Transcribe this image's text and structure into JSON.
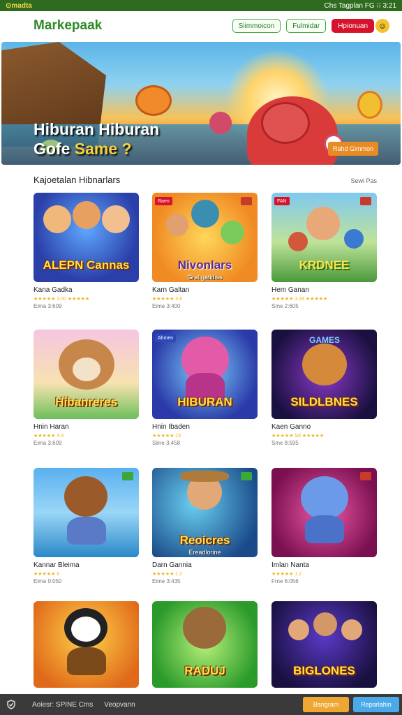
{
  "statusbar": {
    "left": "⊙madta",
    "right": "Chs Tagplan  FG  ⁝⁝ 3:21"
  },
  "topbar": {
    "title": "Markepaak",
    "btn1": "Siimmoicon",
    "btn2": "Fulmidar",
    "btn3": "Hpionuan",
    "smiley": "☺"
  },
  "hero": {
    "line1": "Hiburan Hiburan",
    "line2a": "Gofe ",
    "line2b": "Same ?",
    "cta": "Rahd Gimmon"
  },
  "section": {
    "heading": "Kajoetalan Hibnarlars",
    "link": "Sewi Pas"
  },
  "cards": [
    {
      "title": "ALEPN Cannas",
      "sub": "",
      "name": "Kana Gadka",
      "rating": "★★★★★ 3.00 ★★★★★",
      "meta": "Eima 3:609",
      "tag": ""
    },
    {
      "title": "Nivonlars",
      "sub": "Grst gatidiss",
      "name": "Karn Galtan",
      "rating": "★★★★★ 5.8",
      "meta": "Eime 3:400",
      "tag": "Raen"
    },
    {
      "title": "KRDNEE",
      "sub": "",
      "name": "Hem Ganan",
      "rating": "★★★★★ 3.18 ★★★★★",
      "meta": "Sme 2:605",
      "tag": "FAN"
    },
    {
      "title": "Hibanreres",
      "sub": "",
      "name": "Hnin Haran",
      "rating": "★★★★★ 4.3",
      "meta": "Eima 3:609",
      "tag": ""
    },
    {
      "title": "HIBURAN",
      "sub": "",
      "name": "Hnin Ibaden",
      "rating": "★★★★★ 15",
      "meta": "Siine 3:458",
      "tag": "Ahmen"
    },
    {
      "title": "SILDLBNES",
      "sub": "",
      "name": "Kaen Ganno",
      "rating": "★★★★★ Sd ★★★★★",
      "meta": "Sme 8:595",
      "tag": ""
    },
    {
      "title": "",
      "sub": "",
      "name": "Kannar Bleima",
      "rating": "★★★★★ 6",
      "meta": "Eima 0:050",
      "tag": ""
    },
    {
      "title": "Reoicres",
      "sub": "Ereadlorine",
      "name": "Darn Gannia",
      "rating": "★★★★★ 1.2",
      "meta": "Eime 3:435",
      "tag": ""
    },
    {
      "title": "",
      "sub": "",
      "name": "Imlan Nanta",
      "rating": "★★★★★ 1.2",
      "meta": "Frne 6:056",
      "tag": ""
    },
    {
      "title": "",
      "sub": "",
      "name": "",
      "rating": "",
      "meta": "",
      "tag": ""
    },
    {
      "title": "RADUJ",
      "sub": "",
      "name": "",
      "rating": "",
      "meta": "",
      "tag": ""
    },
    {
      "title": "BIGLONES",
      "sub": "",
      "name": "",
      "rating": "",
      "meta": "",
      "tag": ""
    }
  ],
  "bottombar": {
    "text1": "Aoiesr: SPINE Cms",
    "text2": "Veopvann",
    "btn1": "Bangram",
    "btn2": "Reparlahin"
  },
  "colors": {
    "brand_green": "#2f8a2a",
    "accent_red": "#d6122c",
    "accent_orange": "#f0a632",
    "accent_blue": "#4aa9e9"
  },
  "icons": {
    "status": "coin-icon",
    "bottom_left": "shield-check-icon"
  }
}
